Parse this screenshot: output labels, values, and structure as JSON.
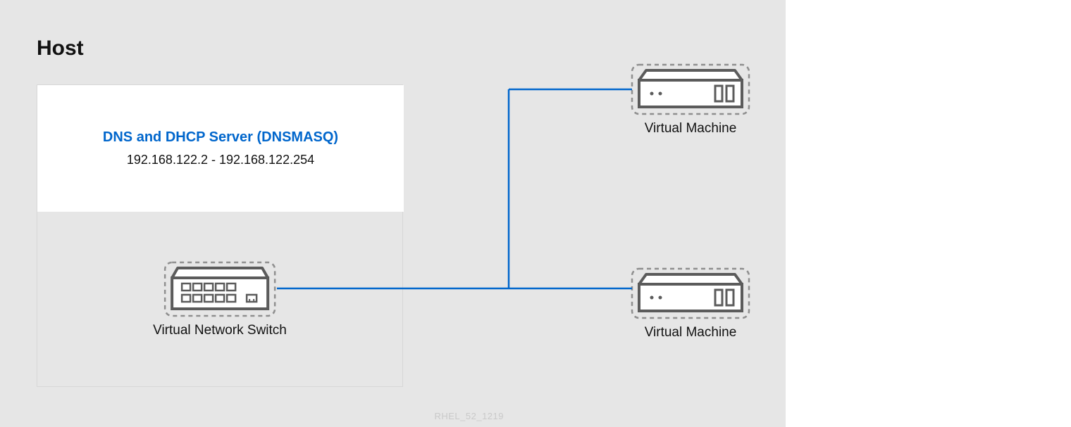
{
  "host": {
    "title": "Host",
    "server": {
      "title": "DNS and DHCP Server (DNSMASQ)",
      "ip_range": "192.168.122.2 - 192.168.122.254"
    },
    "switch": {
      "label": "Virtual Network Switch"
    }
  },
  "vms": {
    "vm1_label": "Virtual Machine",
    "vm2_label": "Virtual Machine"
  },
  "watermark": "RHEL_52_1219",
  "colors": {
    "accent_blue": "#0066cc",
    "wire_blue": "#0066cc",
    "device_gray": "#5b5b5b",
    "dash_gray": "#8f8f8f"
  }
}
